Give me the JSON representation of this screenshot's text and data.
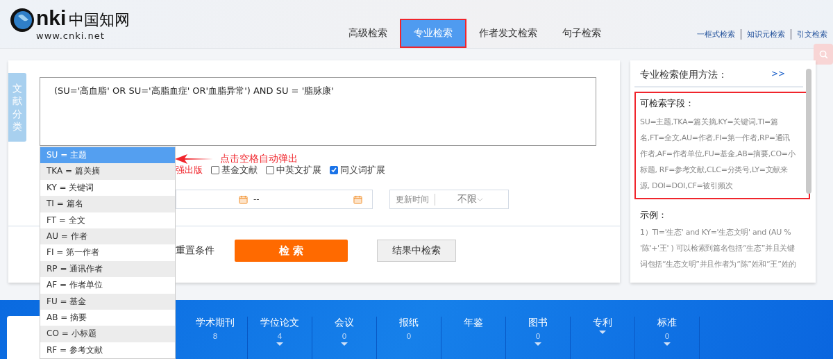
{
  "logo": {
    "letters": "nki",
    "chinese": "中国知网",
    "url": "www.cnki.net"
  },
  "nav_tabs": [
    {
      "label": "高级检索",
      "selected": false,
      "annotated": false
    },
    {
      "label": "专业检索",
      "selected": true,
      "annotated": true
    },
    {
      "label": "作者发文检索",
      "selected": false,
      "annotated": false
    },
    {
      "label": "句子检索",
      "selected": false,
      "annotated": false
    }
  ],
  "quick_links": [
    "一框式检索",
    "知识元检索",
    "引文检索"
  ],
  "side_tab": "文献分类",
  "query": "(SU='高血脂' OR SU='高脂血症' OR'血脂异常') AND SU = '脂脉康'",
  "options": [
    {
      "kind": "note",
      "label": "强出版"
    },
    {
      "kind": "checkbox",
      "label": "基金文献",
      "checked": false
    },
    {
      "kind": "checkbox",
      "label": "中英文扩展",
      "checked": false
    },
    {
      "kind": "checkbox",
      "label": "同义词扩展",
      "checked": true
    }
  ],
  "date_range": {
    "separator": "--"
  },
  "update_time": {
    "label": "更新时间",
    "value": "不限"
  },
  "reset": "重置条件",
  "search_button": "检 索",
  "within_button": "结果中检索",
  "help": {
    "title": "专业检索使用方法：",
    "more": ">>",
    "fields_title": "可检索字段：",
    "fields_lines": [
      "SU=主题,TKA=篇关摘,KY=关键词,TI=篇",
      "名,FT=全文,AU=作者,FI=第一作者,RP=通讯",
      "作者,AF=作者单位,FU=基金,AB=摘要,CO=小",
      "标题, RF=参考文献,CLC=分类号,LY=文献来",
      "源, DOI=DOI,CF=被引频次"
    ],
    "example_title": "示例：",
    "example_lines": [
      "1）TI='生态' and KY='生态文明' and (AU %",
      "'陈'+'王' ) 可以检索到篇名包括“生态”并且关键",
      "词包括“生态文明”并且作者为“陈”姓和“王”姓的"
    ]
  },
  "dropdown": [
    {
      "label": "SU = 主题",
      "selected": true
    },
    {
      "label": "TKA = 篇关摘",
      "selected": false
    },
    {
      "label": "KY = 关键词",
      "selected": false
    },
    {
      "label": "TI = 篇名",
      "selected": false
    },
    {
      "label": "FT = 全文",
      "selected": false
    },
    {
      "label": "AU = 作者",
      "selected": false
    },
    {
      "label": "FI = 第一作者",
      "selected": false
    },
    {
      "label": "RP = 通讯作者",
      "selected": false
    },
    {
      "label": "AF = 作者单位",
      "selected": false
    },
    {
      "label": "FU = 基金",
      "selected": false
    },
    {
      "label": "AB = 摘要",
      "selected": false
    },
    {
      "label": "CO = 小标题",
      "selected": false
    },
    {
      "label": "RF = 参考文献",
      "selected": false
    }
  ],
  "callout": "点击空格自动弹出",
  "categories": [
    {
      "label": "学术期刊",
      "count": "8",
      "caret": false
    },
    {
      "label": "学位论文",
      "count": "4",
      "caret": true
    },
    {
      "label": "会议",
      "count": "0",
      "caret": true
    },
    {
      "label": "报纸",
      "count": "0",
      "caret": false
    },
    {
      "label": "年鉴",
      "caret": false
    },
    {
      "label": "图书",
      "count": "0",
      "caret": true
    },
    {
      "label": "专利",
      "caret": true
    },
    {
      "label": "标准",
      "count": "0",
      "caret": true
    }
  ]
}
